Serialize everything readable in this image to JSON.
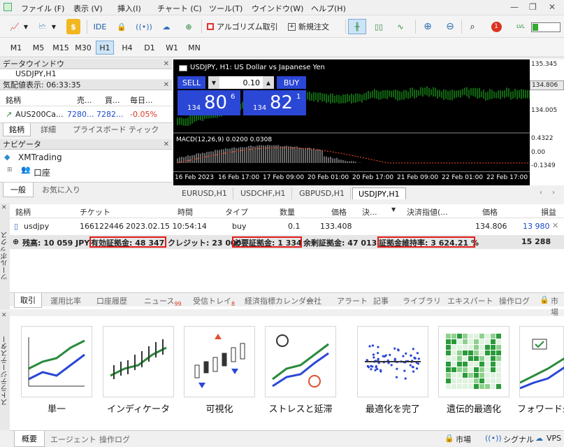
{
  "menu": {
    "items": [
      "ファイル (F)",
      "表示 (V)",
      "挿入(I)",
      "チャート (C)",
      "ツール(T)",
      "ウインドウ(W)",
      "ヘルプ(H)"
    ]
  },
  "toolbar": {
    "ide": "IDE",
    "algo": "アルゴリズム取引",
    "new_order": "新規注文",
    "notif_count": "1",
    "lvl": "LVL"
  },
  "timeframes": [
    "M1",
    "M5",
    "M15",
    "M30",
    "H1",
    "H4",
    "D1",
    "W1",
    "MN"
  ],
  "data_window": {
    "title": "データウインドウ",
    "sub": "USDJPY,H1"
  },
  "market_watch": {
    "title": "気配値表示: 06:33:35",
    "cols": [
      "銘柄",
      "売...",
      "買...",
      "毎日..."
    ],
    "row": {
      "symbol": "AUS200Ca...",
      "bid": "7280...",
      "ask": "7282...",
      "change": "-0.05%"
    },
    "tabs": [
      "銘柄",
      "詳細",
      "プライスボード",
      "ティック"
    ]
  },
  "navigator": {
    "title": "ナビゲータ",
    "broker": "XMTrading",
    "account": "口座",
    "tabs": [
      "一般",
      "お気に入り"
    ]
  },
  "chart": {
    "header": "USDJPY, H1:  US Dollar vs Japanese Yen",
    "sell": "SELL",
    "buy": "BUY",
    "volume": "0.10",
    "sell_small": "134",
    "sell_big": "80",
    "sell_sup": "6",
    "buy_small": "134",
    "buy_big": "82",
    "buy_sup": "1",
    "macd": "MACD(12,26,9) 0.0200 0.0308",
    "price_axis": [
      "135.345",
      "134.806",
      "134.005"
    ],
    "macd_axis": [
      "0.4322",
      "0.00",
      "-0.1349"
    ],
    "time_axis": [
      "16 Feb 2023",
      "16 Feb 17:00",
      "17 Feb 09:00",
      "20 Feb 01:00",
      "20 Feb 17:00",
      "21 Feb 09:00",
      "22 Feb 01:00",
      "22 Feb 17:00"
    ],
    "tabs": [
      "EURUSD,H1",
      "USDCHF,H1",
      "GBPUSD,H1",
      "USDJPY,H1"
    ]
  },
  "trade": {
    "headers": [
      "銘柄",
      "チケット",
      "時間",
      "タイプ",
      "数量",
      "価格",
      "決...",
      "決済指値(...",
      "価格",
      "損益"
    ],
    "row": [
      "usdjpy",
      "166122446",
      "2023.02.15 10:54:14",
      "buy",
      "0.1",
      "133.408",
      "",
      "",
      "134.806",
      "13 980"
    ],
    "summary": {
      "balance": "残高: 10 059 JPY",
      "equity": "有効証拠金: 48 347",
      "credit": "クレジット: 23 000",
      "margin": "必要証拠金: 1 334",
      "free": "余剰証拠金: 47 013",
      "level": "証拠金維持率: 3 624.21 %",
      "total": "15 288"
    },
    "tabs": [
      "取引",
      "運用比率",
      "口座履歴",
      "ニュース",
      "受信トレイ",
      "経済指標カレンダー",
      "会社",
      "アラート",
      "記事",
      "ライブラリ",
      "エキスパート",
      "操作ログ",
      "市場"
    ],
    "news_badge": "99",
    "inbox_badge": "8",
    "side_label": "ツールボックス"
  },
  "tester": {
    "cards": [
      "単一",
      "インディケータ",
      "可視化",
      "ストレスと延滞",
      "最適化を完了",
      "遺伝的最適化",
      "フォワード最"
    ],
    "tabs": [
      "概要",
      "エージェント",
      "操作ログ"
    ],
    "side_label": "ストラテジーテスター"
  },
  "status": {
    "market": "市場",
    "signal": "シグナル",
    "vps": "VPS"
  }
}
